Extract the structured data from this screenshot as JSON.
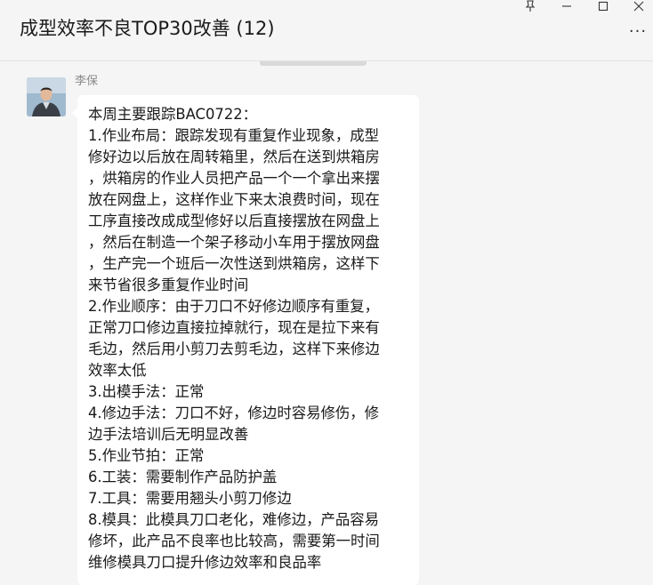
{
  "window": {
    "title": "成型效率不良TOP30改善 (12)",
    "controls": {
      "pin_icon": "pin-icon",
      "minimize_icon": "minimize-icon",
      "maximize_icon": "maximize-icon",
      "close_icon": "close-icon"
    },
    "more_label": "···"
  },
  "message": {
    "sender": "李保",
    "lines": [
      "本周主要跟踪BAC0722：",
      "1.作业布局：跟踪发现有重复作业现象，成型",
      "修好边以后放在周转箱里，然后在送到烘箱房",
      "，烘箱房的作业人员把产品一个一个拿出来摆",
      "放在网盘上，这样作业下来太浪费时间，现在",
      "工序直接改成成型修好以后直接摆放在网盘上",
      "，然后在制造一个架子移动小车用于摆放网盘",
      "，生产完一个班后一次性送到烘箱房，这样下",
      "来节省很多重复作业时间",
      "2.作业顺序：由于刀口不好修边顺序有重复，",
      "正常刀口修边直接拉掉就行，现在是拉下来有",
      "毛边，然后用小剪刀去剪毛边，这样下来修边",
      "效率太低",
      "3.出模手法：正常",
      "4.修边手法：刀口不好，修边时容易修伤，修",
      "边手法培训后无明显改善",
      "5.作业节拍：正常",
      "6.工装：需要制作产品防护盖",
      "7.工具：需要用翘头小剪刀修边",
      "8.模具：此模具刀口老化，难修边，产品容易",
      "修坏，此产品不良率也比较高，需要第一时间",
      "维修模具刀口提升修边效率和良品率"
    ]
  },
  "colors": {
    "background": "#f5f5f5",
    "bubble": "#ffffff",
    "sender_text": "#8a8a8a"
  }
}
